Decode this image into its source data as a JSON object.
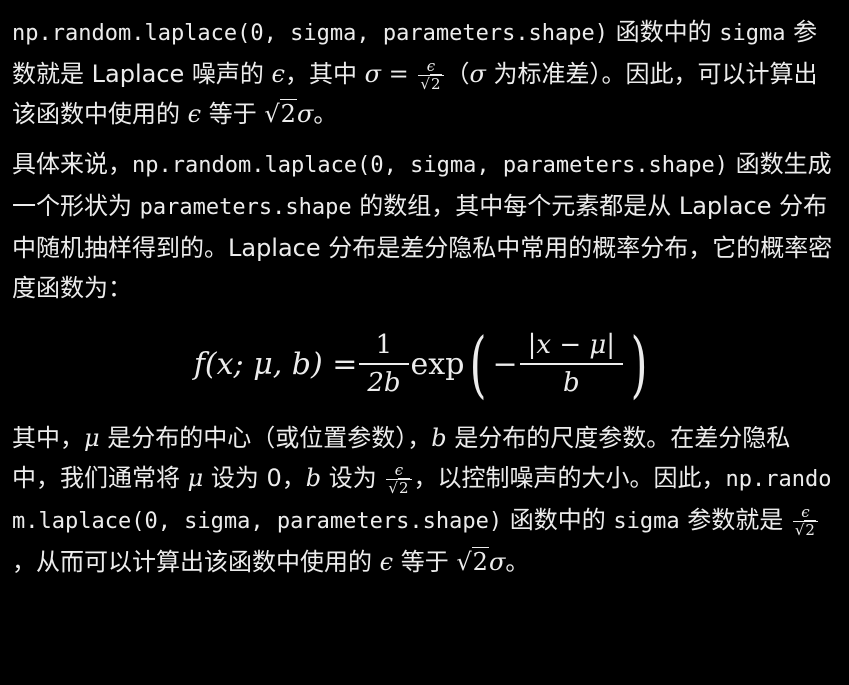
{
  "p1": {
    "code1": "np.random.laplace(0, sigma, parameters.shape)",
    "t1": " 函数中的 ",
    "code2": "sigma",
    "t2": " 参数就是 Laplace 噪声的 ",
    "eps": "ϵ",
    "t3": "，其中 ",
    "sigma_eq": "σ = ",
    "frac_num": "ϵ",
    "frac_den": "2",
    "t4": "（",
    "sigma2": "σ",
    "t5": " 为标准差）。因此，可以计算出该函数中使用的 ",
    "eps2": "ϵ",
    "t6": " 等于 ",
    "sqrt_arg": "2",
    "sigma3": "σ",
    "t7": "。"
  },
  "p2": {
    "t1": "具体来说，",
    "code1": "np.random.laplace(0, sigma, parameters.shape)",
    "t2": " 函数生成一个形状为 ",
    "code2": "parameters.shape",
    "t3": " 的数组，其中每个元素都是从 Laplace 分布中随机抽样得到的。Laplace 分布是差分隐私中常用的概率分布，它的概率密度函数为："
  },
  "formula": {
    "lhs": "f(x; μ, b) = ",
    "frac_num": "1",
    "frac_den": "2b",
    "exp": "exp",
    "inner_sign": "−",
    "inner_num": "|x − μ|",
    "inner_den": "b"
  },
  "p3": {
    "t1": "其中，",
    "mu": "μ",
    "t2": " 是分布的中心（或位置参数），",
    "b": "b",
    "t3": " 是分布的尺度参数。在差分隐私中，我们通常将 ",
    "mu2": "μ",
    "t4": " 设为 0，",
    "b2": "b",
    "t5": " 设为 ",
    "frac_num": "ϵ",
    "frac_den": "2",
    "t6": "，以控制噪声的大小。因此，",
    "code1": "np.random.laplace(0, sigma, parameters.shape)",
    "t7": " 函数中的 ",
    "code2": "sigma",
    "t8": " 参数就是 ",
    "frac2_num": "ϵ",
    "frac2_den": "2",
    "t9": "，从而可以计算出该函数中使用的 ",
    "eps": "ϵ",
    "t10": " 等于 ",
    "sqrt_arg": "2",
    "sigma": "σ",
    "t11": "。"
  }
}
